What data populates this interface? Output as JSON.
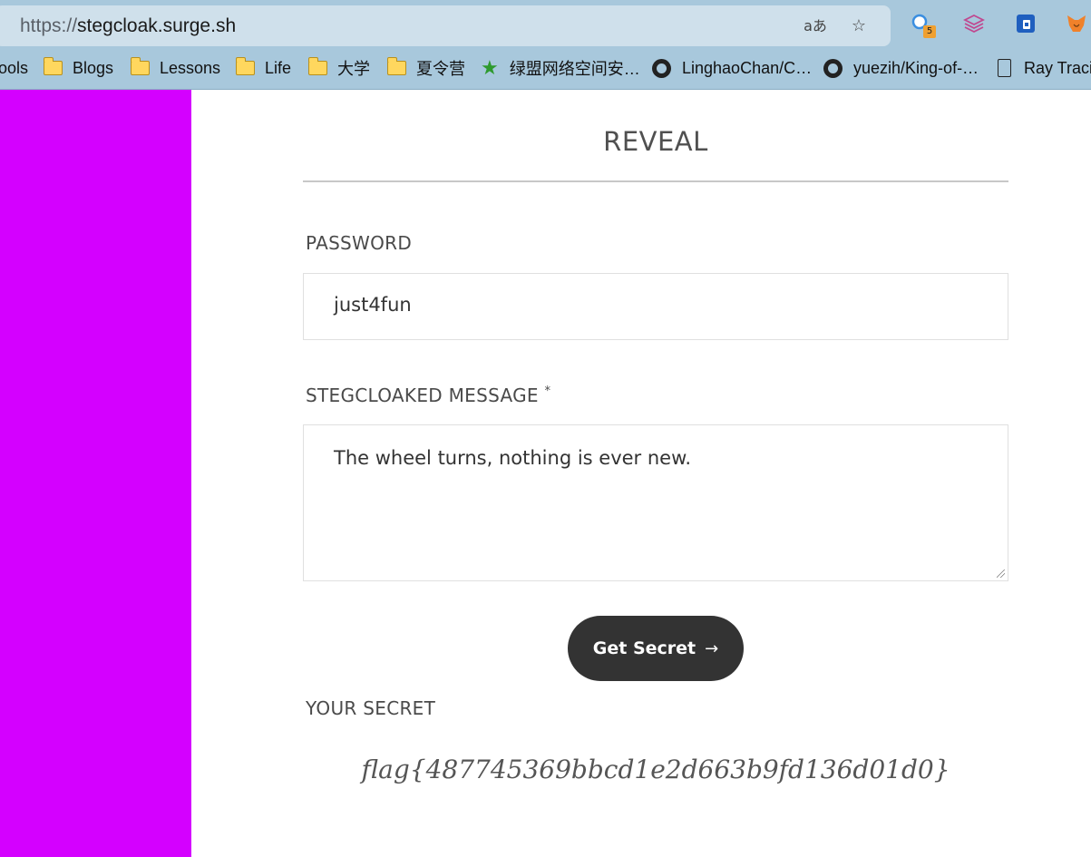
{
  "browser": {
    "url_protocol": "https://",
    "url_host": "stegcloak.surge.sh",
    "ext_badge": "5",
    "bookmarks": [
      {
        "label": "ools",
        "kind": "text"
      },
      {
        "label": "Blogs",
        "kind": "folder"
      },
      {
        "label": "Lessons",
        "kind": "folder"
      },
      {
        "label": "Life",
        "kind": "folder"
      },
      {
        "label": "大学",
        "kind": "folder"
      },
      {
        "label": "夏令营",
        "kind": "folder"
      },
      {
        "label": "绿盟网络空间安…",
        "kind": "star"
      },
      {
        "label": "LinghaoChan/C…",
        "kind": "github"
      },
      {
        "label": "yuezih/King-of-…",
        "kind": "github"
      },
      {
        "label": "Ray Tracin",
        "kind": "page"
      }
    ]
  },
  "reveal": {
    "title": "REVEAL",
    "password_label": "PASSWORD",
    "password_value": "just4fun",
    "message_label": "STEGCLOAKED MESSAGE",
    "required_mark": "*",
    "message_value": "The wheel turns, nothing is ever new.",
    "button_label": "Get Secret",
    "button_arrow": "→",
    "secret_label": "YOUR SECRET",
    "secret_value": "flag{487745369bbcd1e2d663b9fd136d01d0}"
  },
  "colors": {
    "sidebar": "#d400ff",
    "button": "#333333",
    "chrome": "#a8c8dc"
  }
}
